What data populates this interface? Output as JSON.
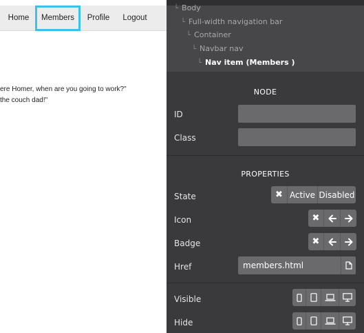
{
  "preview": {
    "nav": [
      "Home",
      "Members",
      "Profile",
      "Logout"
    ],
    "quote_lines": [
      "ere Homer, when are you going to work?\"",
      " the couch dad!\""
    ]
  },
  "tree": {
    "items": [
      "Body",
      "Full-width navigation bar",
      "Container",
      "Navbar nav",
      "Nav item (Members )"
    ]
  },
  "node": {
    "title": "NODE",
    "id_label": "ID",
    "class_label": "Class"
  },
  "properties": {
    "title": "PROPERTIES",
    "state_label": "State",
    "state_options": [
      "Active",
      "Disabled"
    ],
    "icon_label": "Icon",
    "badge_label": "Badge",
    "href_label": "Href",
    "href_value": "members.html"
  },
  "visibility": {
    "visible_label": "Visible",
    "hide_label": "Hide"
  },
  "colors": {
    "panel_bg": "#3a3a3c",
    "tree_bg": "#474749",
    "control_bg": "#6a6a6c",
    "selection_outline": "#3cc2ea"
  },
  "icons": {
    "clear": "x-icon",
    "arrows": [
      "arrow-left-icon",
      "arrow-right-icon"
    ],
    "devices": [
      "phone-icon",
      "tablet-icon",
      "laptop-icon",
      "desktop-icon"
    ],
    "file": "file-icon"
  }
}
